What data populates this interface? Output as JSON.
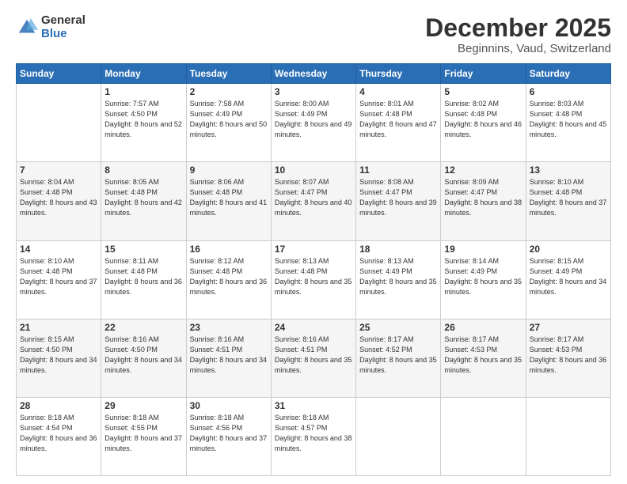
{
  "logo": {
    "general": "General",
    "blue": "Blue"
  },
  "header": {
    "title": "December 2025",
    "subtitle": "Beginnins, Vaud, Switzerland"
  },
  "weekdays": [
    "Sunday",
    "Monday",
    "Tuesday",
    "Wednesday",
    "Thursday",
    "Friday",
    "Saturday"
  ],
  "weeks": [
    [
      {
        "day": "",
        "sunrise": "",
        "sunset": "",
        "daylight": ""
      },
      {
        "day": "1",
        "sunrise": "Sunrise: 7:57 AM",
        "sunset": "Sunset: 4:50 PM",
        "daylight": "Daylight: 8 hours and 52 minutes."
      },
      {
        "day": "2",
        "sunrise": "Sunrise: 7:58 AM",
        "sunset": "Sunset: 4:49 PM",
        "daylight": "Daylight: 8 hours and 50 minutes."
      },
      {
        "day": "3",
        "sunrise": "Sunrise: 8:00 AM",
        "sunset": "Sunset: 4:49 PM",
        "daylight": "Daylight: 8 hours and 49 minutes."
      },
      {
        "day": "4",
        "sunrise": "Sunrise: 8:01 AM",
        "sunset": "Sunset: 4:48 PM",
        "daylight": "Daylight: 8 hours and 47 minutes."
      },
      {
        "day": "5",
        "sunrise": "Sunrise: 8:02 AM",
        "sunset": "Sunset: 4:48 PM",
        "daylight": "Daylight: 8 hours and 46 minutes."
      },
      {
        "day": "6",
        "sunrise": "Sunrise: 8:03 AM",
        "sunset": "Sunset: 4:48 PM",
        "daylight": "Daylight: 8 hours and 45 minutes."
      }
    ],
    [
      {
        "day": "7",
        "sunrise": "Sunrise: 8:04 AM",
        "sunset": "Sunset: 4:48 PM",
        "daylight": "Daylight: 8 hours and 43 minutes."
      },
      {
        "day": "8",
        "sunrise": "Sunrise: 8:05 AM",
        "sunset": "Sunset: 4:48 PM",
        "daylight": "Daylight: 8 hours and 42 minutes."
      },
      {
        "day": "9",
        "sunrise": "Sunrise: 8:06 AM",
        "sunset": "Sunset: 4:48 PM",
        "daylight": "Daylight: 8 hours and 41 minutes."
      },
      {
        "day": "10",
        "sunrise": "Sunrise: 8:07 AM",
        "sunset": "Sunset: 4:47 PM",
        "daylight": "Daylight: 8 hours and 40 minutes."
      },
      {
        "day": "11",
        "sunrise": "Sunrise: 8:08 AM",
        "sunset": "Sunset: 4:47 PM",
        "daylight": "Daylight: 8 hours and 39 minutes."
      },
      {
        "day": "12",
        "sunrise": "Sunrise: 8:09 AM",
        "sunset": "Sunset: 4:47 PM",
        "daylight": "Daylight: 8 hours and 38 minutes."
      },
      {
        "day": "13",
        "sunrise": "Sunrise: 8:10 AM",
        "sunset": "Sunset: 4:48 PM",
        "daylight": "Daylight: 8 hours and 37 minutes."
      }
    ],
    [
      {
        "day": "14",
        "sunrise": "Sunrise: 8:10 AM",
        "sunset": "Sunset: 4:48 PM",
        "daylight": "Daylight: 8 hours and 37 minutes."
      },
      {
        "day": "15",
        "sunrise": "Sunrise: 8:11 AM",
        "sunset": "Sunset: 4:48 PM",
        "daylight": "Daylight: 8 hours and 36 minutes."
      },
      {
        "day": "16",
        "sunrise": "Sunrise: 8:12 AM",
        "sunset": "Sunset: 4:48 PM",
        "daylight": "Daylight: 8 hours and 36 minutes."
      },
      {
        "day": "17",
        "sunrise": "Sunrise: 8:13 AM",
        "sunset": "Sunset: 4:48 PM",
        "daylight": "Daylight: 8 hours and 35 minutes."
      },
      {
        "day": "18",
        "sunrise": "Sunrise: 8:13 AM",
        "sunset": "Sunset: 4:49 PM",
        "daylight": "Daylight: 8 hours and 35 minutes."
      },
      {
        "day": "19",
        "sunrise": "Sunrise: 8:14 AM",
        "sunset": "Sunset: 4:49 PM",
        "daylight": "Daylight: 8 hours and 35 minutes."
      },
      {
        "day": "20",
        "sunrise": "Sunrise: 8:15 AM",
        "sunset": "Sunset: 4:49 PM",
        "daylight": "Daylight: 8 hours and 34 minutes."
      }
    ],
    [
      {
        "day": "21",
        "sunrise": "Sunrise: 8:15 AM",
        "sunset": "Sunset: 4:50 PM",
        "daylight": "Daylight: 8 hours and 34 minutes."
      },
      {
        "day": "22",
        "sunrise": "Sunrise: 8:16 AM",
        "sunset": "Sunset: 4:50 PM",
        "daylight": "Daylight: 8 hours and 34 minutes."
      },
      {
        "day": "23",
        "sunrise": "Sunrise: 8:16 AM",
        "sunset": "Sunset: 4:51 PM",
        "daylight": "Daylight: 8 hours and 34 minutes."
      },
      {
        "day": "24",
        "sunrise": "Sunrise: 8:16 AM",
        "sunset": "Sunset: 4:51 PM",
        "daylight": "Daylight: 8 hours and 35 minutes."
      },
      {
        "day": "25",
        "sunrise": "Sunrise: 8:17 AM",
        "sunset": "Sunset: 4:52 PM",
        "daylight": "Daylight: 8 hours and 35 minutes."
      },
      {
        "day": "26",
        "sunrise": "Sunrise: 8:17 AM",
        "sunset": "Sunset: 4:53 PM",
        "daylight": "Daylight: 8 hours and 35 minutes."
      },
      {
        "day": "27",
        "sunrise": "Sunrise: 8:17 AM",
        "sunset": "Sunset: 4:53 PM",
        "daylight": "Daylight: 8 hours and 36 minutes."
      }
    ],
    [
      {
        "day": "28",
        "sunrise": "Sunrise: 8:18 AM",
        "sunset": "Sunset: 4:54 PM",
        "daylight": "Daylight: 8 hours and 36 minutes."
      },
      {
        "day": "29",
        "sunrise": "Sunrise: 8:18 AM",
        "sunset": "Sunset: 4:55 PM",
        "daylight": "Daylight: 8 hours and 37 minutes."
      },
      {
        "day": "30",
        "sunrise": "Sunrise: 8:18 AM",
        "sunset": "Sunset: 4:56 PM",
        "daylight": "Daylight: 8 hours and 37 minutes."
      },
      {
        "day": "31",
        "sunrise": "Sunrise: 8:18 AM",
        "sunset": "Sunset: 4:57 PM",
        "daylight": "Daylight: 8 hours and 38 minutes."
      },
      {
        "day": "",
        "sunrise": "",
        "sunset": "",
        "daylight": ""
      },
      {
        "day": "",
        "sunrise": "",
        "sunset": "",
        "daylight": ""
      },
      {
        "day": "",
        "sunrise": "",
        "sunset": "",
        "daylight": ""
      }
    ]
  ]
}
